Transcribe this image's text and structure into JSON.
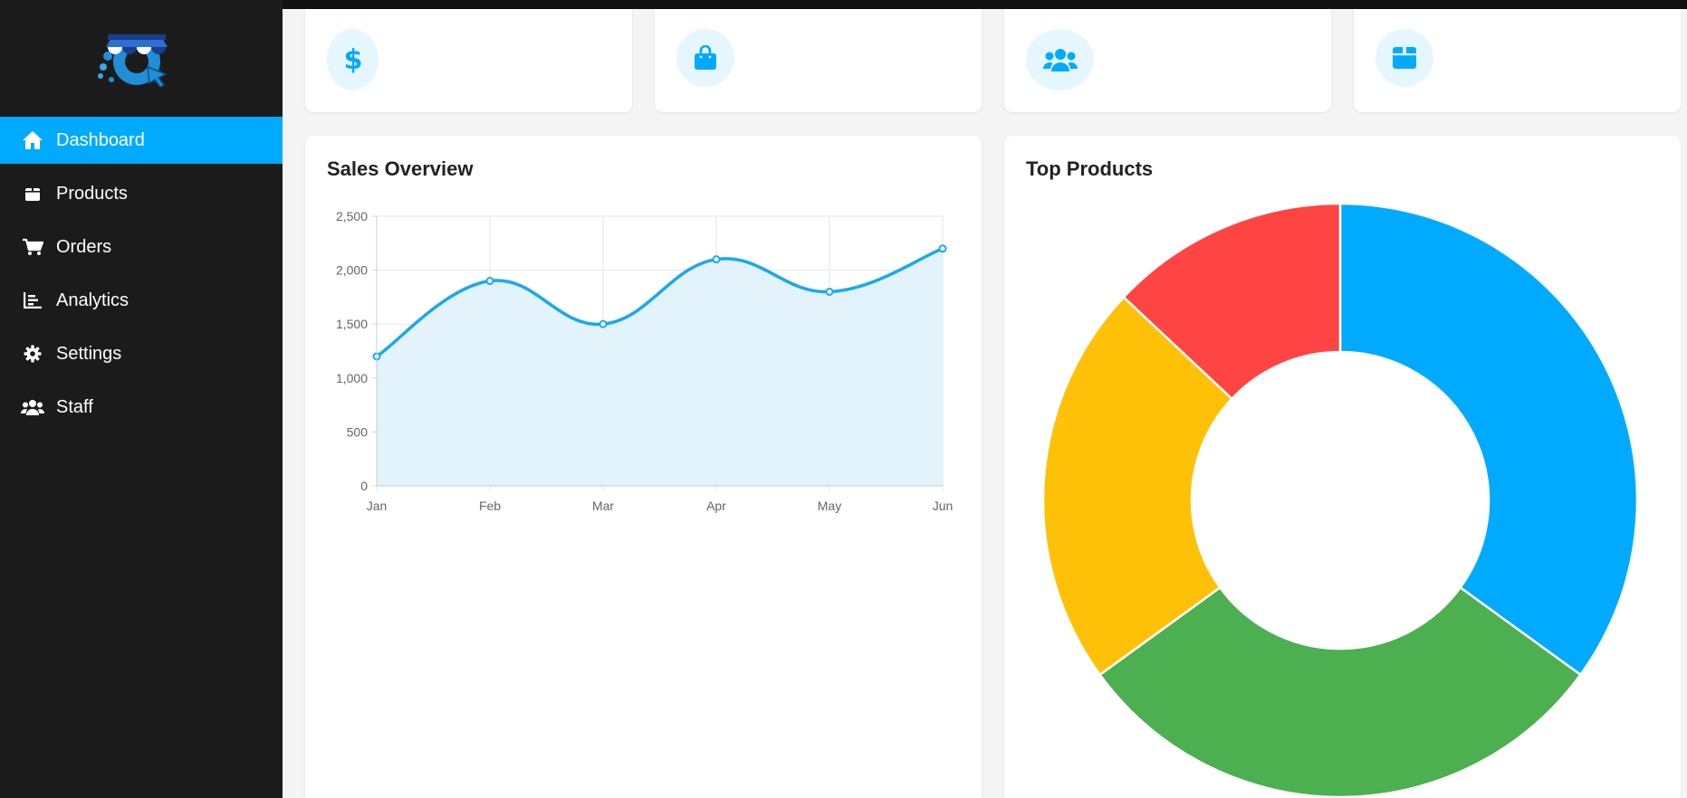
{
  "sidebar": {
    "items": [
      {
        "label": "Dashboard",
        "icon": "home-icon",
        "active": true
      },
      {
        "label": "Products",
        "icon": "box-icon",
        "active": false
      },
      {
        "label": "Orders",
        "icon": "cart-icon",
        "active": false
      },
      {
        "label": "Analytics",
        "icon": "bar-chart-icon",
        "active": false
      },
      {
        "label": "Settings",
        "icon": "gear-icon",
        "active": false
      },
      {
        "label": "Staff",
        "icon": "users-icon",
        "active": false
      }
    ]
  },
  "stats": [
    {
      "icon": "dollar-icon"
    },
    {
      "icon": "shopping-bag-icon"
    },
    {
      "icon": "users-icon"
    },
    {
      "icon": "box-icon"
    }
  ],
  "colors": {
    "accent": "#00aaff",
    "sidebar_bg": "#1b1b1b",
    "sales_line": "#1aa8f0",
    "sales_fill": "#e3f3fb"
  },
  "sales_panel": {
    "title": "Sales Overview"
  },
  "top_products_panel": {
    "title": "Top Products"
  },
  "chart_data": [
    {
      "type": "line",
      "title": "Sales Overview",
      "categories": [
        "Jan",
        "Feb",
        "Mar",
        "Apr",
        "May",
        "Jun"
      ],
      "values": [
        1200,
        1900,
        1500,
        2100,
        1800,
        2200
      ],
      "ylim": [
        0,
        2500
      ],
      "yticks": [
        "0",
        "500",
        "1,000",
        "1,500",
        "2,000",
        "2,500"
      ],
      "grid": true,
      "filled": true,
      "color": "#1aa8f0"
    },
    {
      "type": "pie",
      "title": "Top Products",
      "donut": true,
      "values": [
        35,
        30,
        22,
        13
      ],
      "colors": [
        "#00aaff",
        "#4caf50",
        "#ffc107",
        "#ff4444"
      ]
    }
  ]
}
